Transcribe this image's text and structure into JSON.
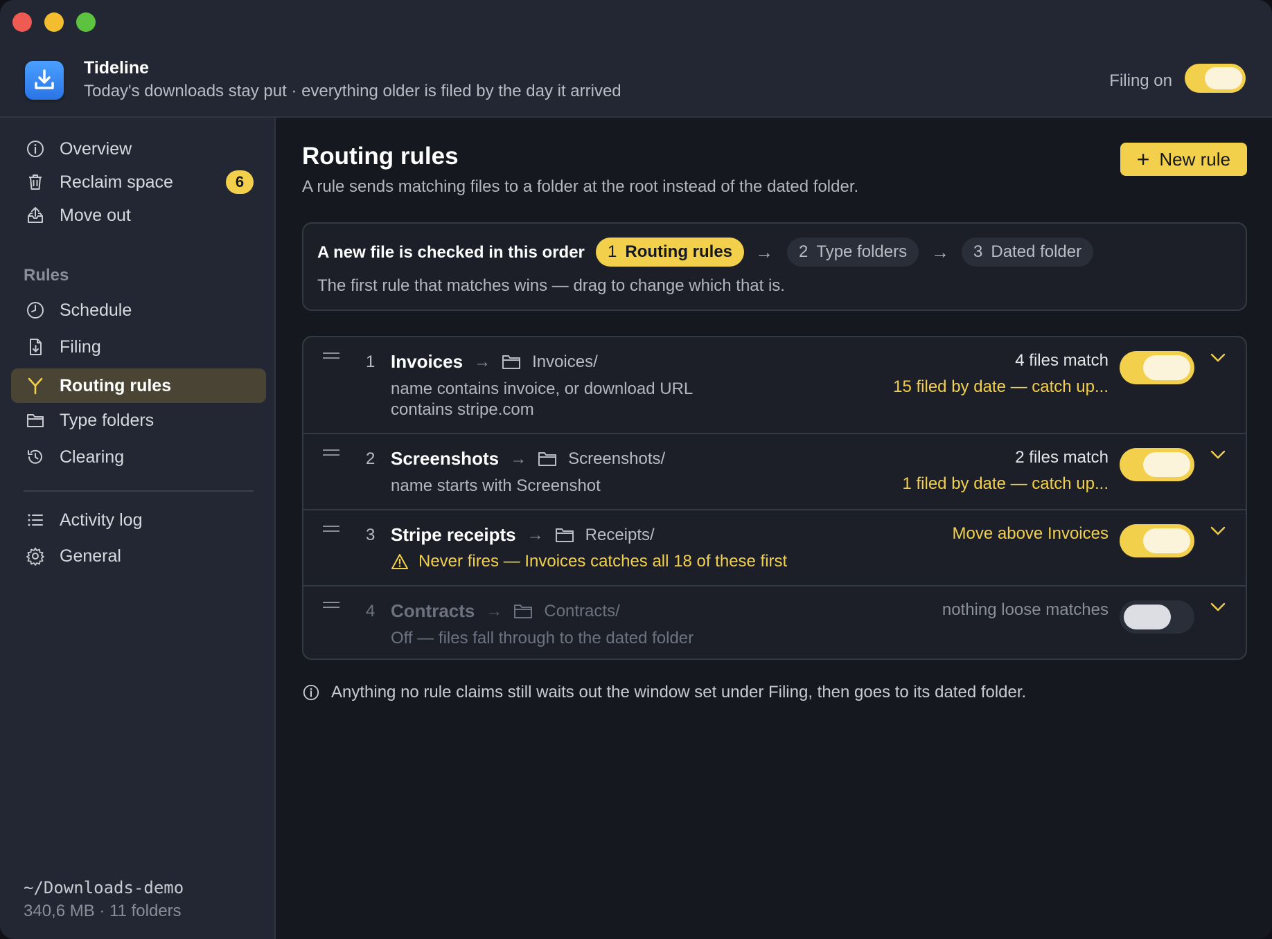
{
  "app": {
    "title": "Tideline",
    "subtitle": "Today's downloads stay put · everything older is filed by the day it arrived",
    "filing_label": "Filing on",
    "filing_on": true
  },
  "sidebar": {
    "items": [
      {
        "label": "Overview",
        "icon": "info-icon"
      },
      {
        "label": "Reclaim space",
        "icon": "trash-icon",
        "badge": "6"
      },
      {
        "label": "Move out",
        "icon": "tray-out-icon"
      }
    ],
    "section_label": "Rules",
    "rule_items": [
      {
        "label": "Schedule",
        "icon": "clock-icon"
      },
      {
        "label": "Filing",
        "icon": "file-icon"
      },
      {
        "label": "Routing rules",
        "icon": "fork-icon",
        "active": true
      },
      {
        "label": "Type folders",
        "icon": "folder-icon"
      },
      {
        "label": "Clearing",
        "icon": "history-icon"
      }
    ],
    "bottom_items": [
      {
        "label": "Activity log",
        "icon": "list-icon"
      },
      {
        "label": "General",
        "icon": "gear-icon"
      }
    ],
    "footer": {
      "path": "~/Downloads-demo",
      "meta": "340,6 MB · 11 folders"
    }
  },
  "main": {
    "title": "Routing rules",
    "subtitle": "A rule sends matching files to a folder at the root instead of the dated folder.",
    "new_rule_label": "New rule",
    "order": {
      "title": "A new file is checked in this order",
      "steps": [
        {
          "n": "1",
          "label": "Routing rules",
          "active": true
        },
        {
          "n": "2",
          "label": "Type folders"
        },
        {
          "n": "3",
          "label": "Dated folder"
        }
      ],
      "note": "The first rule that matches wins — drag to change which that is."
    },
    "rules": [
      {
        "num": "1",
        "name": "Invoices",
        "dest": "Invoices/",
        "desc_line1": "name contains invoice, or download URL",
        "desc_line2": "contains stripe.com",
        "match": "4 files match",
        "warn": "15 filed by date — catch up...",
        "enabled": true
      },
      {
        "num": "2",
        "name": "Screenshots",
        "dest": "Screenshots/",
        "desc_line1": "name starts with Screenshot",
        "match": "2 files match",
        "warn": "1 filed by date — catch up...",
        "enabled": true
      },
      {
        "num": "3",
        "name": "Stripe receipts",
        "dest": "Receipts/",
        "warning": "Never fires — Invoices catches all 18 of these first",
        "action": "Move above Invoices",
        "enabled": true
      },
      {
        "num": "4",
        "name": "Contracts",
        "dest": "Contracts/",
        "desc_line1": "Off — files fall through to the dated folder",
        "match": "nothing loose matches",
        "enabled": false
      }
    ],
    "footnote": "Anything no rule claims still waits out the window set under Filing, then goes to its dated folder."
  },
  "colors": {
    "accent": "#f3d04b",
    "background": "#16181f",
    "sidebar": "#232733"
  }
}
